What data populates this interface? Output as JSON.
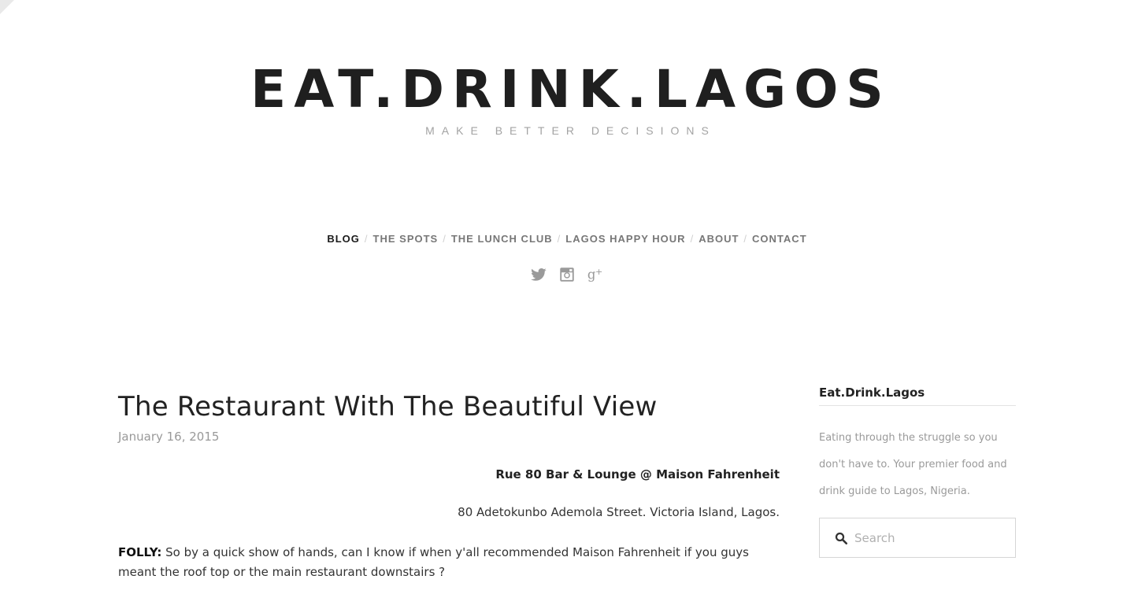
{
  "site": {
    "title": "EAT.DRINK.LAGOS",
    "tagline": "MAKE BETTER DECISIONS"
  },
  "nav": {
    "items": [
      {
        "label": "BLOG",
        "active": true
      },
      {
        "label": "THE SPOTS",
        "active": false
      },
      {
        "label": "THE LUNCH CLUB",
        "active": false
      },
      {
        "label": "LAGOS HAPPY HOUR",
        "active": false
      },
      {
        "label": "ABOUT",
        "active": false
      },
      {
        "label": "CONTACT",
        "active": false
      }
    ],
    "separator": "/"
  },
  "social": {
    "icons": [
      "twitter-icon",
      "instagram-icon",
      "google-plus-icon"
    ],
    "color": "#9a9a9a"
  },
  "post": {
    "title": "The Restaurant With The Beautiful View",
    "date": "January 16, 2015",
    "venue_name": "Rue 80 Bar & Lounge @ Maison Fahrenheit",
    "venue_address": "80 Adetokunbo Ademola Street. Victoria Island, Lagos.",
    "body_lead": "FOLLY:",
    "body_text": " So by a quick show of hands, can I know if when y'all recommended Maison Fahrenheit if you guys meant the roof top or the main restaurant downstairs ?"
  },
  "sidebar": {
    "widget_title": "Eat.Drink.Lagos",
    "widget_text": "Eating through the struggle so you don't have to. Your premier food and drink guide to Lagos, Nigeria.",
    "search_placeholder": "Search",
    "search_value": ""
  }
}
